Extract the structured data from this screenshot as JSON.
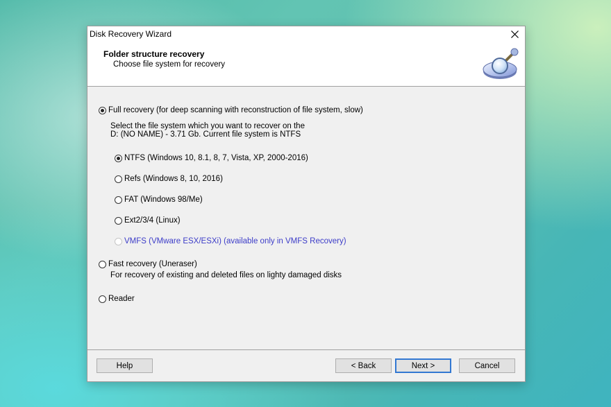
{
  "window": {
    "title": "Disk Recovery Wizard"
  },
  "header": {
    "title": "Folder structure recovery",
    "subtitle": "Choose file system for recovery",
    "icon": "disk-magnifier-icon"
  },
  "options": {
    "full_recovery": {
      "label": "Full recovery (for deep scanning with reconstruction of file system, slow)",
      "selected": true,
      "description_line1": "Select the file system which you want to recover on the",
      "description_line2": "D: (NO NAME) - 3.71 Gb. Current file system is NTFS",
      "filesystems": [
        {
          "label": "NTFS (Windows 10, 8.1, 8, 7, Vista, XP, 2000-2016)",
          "selected": true,
          "enabled": true
        },
        {
          "label": "Refs (Windows 8, 10, 2016)",
          "selected": false,
          "enabled": true
        },
        {
          "label": "FAT (Windows 98/Me)",
          "selected": false,
          "enabled": true
        },
        {
          "label": "Ext2/3/4 (Linux)",
          "selected": false,
          "enabled": true
        },
        {
          "label": "VMFS (VMware ESX/ESXi) (available only in VMFS Recovery)",
          "selected": false,
          "enabled": false
        }
      ]
    },
    "fast_recovery": {
      "label": "Fast recovery (Uneraser)",
      "selected": false,
      "description": "For recovery of existing and deleted files on lighty damaged disks"
    },
    "reader": {
      "label": "Reader",
      "selected": false
    }
  },
  "buttons": {
    "help": "Help",
    "back": "< Back",
    "next": "Next >",
    "cancel": "Cancel"
  },
  "colors": {
    "disabled_text": "#3c3cc8",
    "default_button_border": "#3278d2"
  }
}
